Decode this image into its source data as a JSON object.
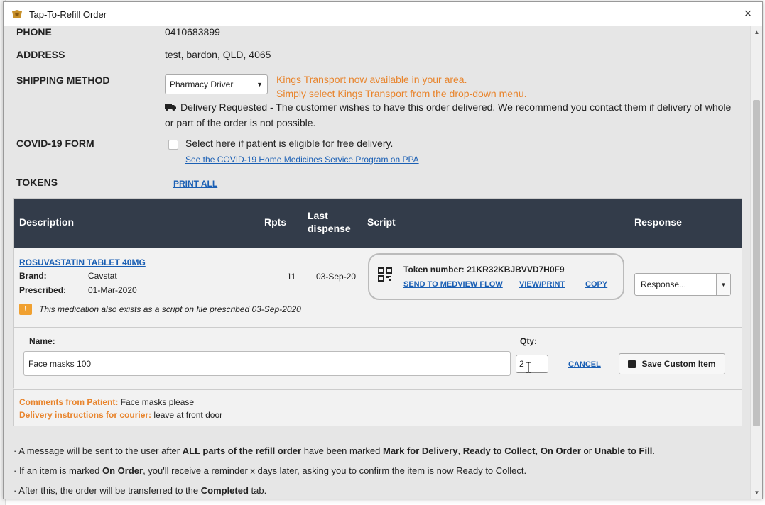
{
  "window": {
    "title": "Tap-To-Refill Order",
    "close_label": "×"
  },
  "fields": {
    "phone_label": "PHONE",
    "phone_value": "0410683899",
    "address_label": "ADDRESS",
    "address_value": "test, bardon, QLD, 4065",
    "shipping_label": "SHIPPING METHOD",
    "shipping_selected": "Pharmacy Driver",
    "kings_line1": "Kings Transport now available in your area.",
    "kings_line2": "Simply select Kings Transport from the drop-down menu.",
    "delivery_note": "Delivery Requested - The customer wishes to have this order delivered. We recommend you contact them if delivery of whole or part of the order is not possible.",
    "covid_label": "COVID-19 FORM",
    "covid_checkbox_text": "Select here if patient is eligible for free delivery.",
    "covid_link": "See the COVID-19 Home Medicines Service Program on PPA",
    "tokens_label": "TOKENS",
    "print_all": "PRINT ALL"
  },
  "table": {
    "headers": {
      "description": "Description",
      "rpts": "Rpts",
      "last_dispense_1": "Last",
      "last_dispense_2": "dispense",
      "script": "Script",
      "response": "Response"
    },
    "row": {
      "medication": "ROSUVASTATIN TABLET 40MG",
      "brand_label": "Brand:",
      "brand_value": "Cavstat",
      "prescribed_label": "Prescribed:",
      "prescribed_value": "01-Mar-2020",
      "rpts": "11",
      "last_dispense": "03-Sep-20",
      "token_number": "Token number: 21KR32KBJBVVD7H0F9",
      "send_to_medview": "SEND TO MEDVIEW FLOW",
      "view_print": "VIEW/PRINT",
      "copy": "COPY",
      "response_selected": "Response...",
      "warning_icon": "!",
      "warning_text": "This medication also exists as a script on file prescribed 03-Sep-2020"
    },
    "custom_item": {
      "name_label": "Name:",
      "qty_label": "Qty:",
      "name_value": "Face masks 100",
      "qty_value": "2",
      "cancel": "CANCEL",
      "save": "Save Custom Item"
    }
  },
  "comments": {
    "patient_label": "Comments from Patient:",
    "patient_value": "Face masks please",
    "courier_label": "Delivery instructions for courier:",
    "courier_value": "leave at front door"
  },
  "bullets": {
    "b1_pre": "· A message will be sent to the user after ",
    "b1_bold1": "ALL parts of the refill order",
    "b1_mid1": " have been marked ",
    "b1_bold2": "Mark for Delivery",
    "b1_sep1": ", ",
    "b1_bold3": "Ready to Collect",
    "b1_sep2": ", ",
    "b1_bold4": "On Order",
    "b1_sep3": " or ",
    "b1_bold5": "Unable to Fill",
    "b1_end": ".",
    "b2_pre": "· If an item is marked ",
    "b2_bold": "On Order",
    "b2_end": ", you'll receive a reminder x days later, asking you to confirm the item is now Ready to Collect.",
    "b3_pre": "· After this, the order will be transferred to the ",
    "b3_bold": "Completed",
    "b3_end": " tab."
  }
}
